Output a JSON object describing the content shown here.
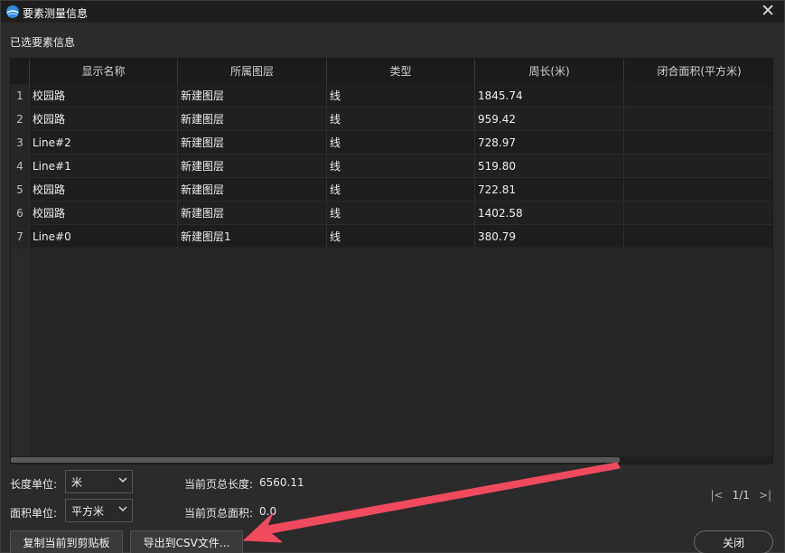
{
  "window": {
    "title": "要素测量信息"
  },
  "section": {
    "label": "已选要素信息"
  },
  "table": {
    "columns": [
      "显示名称",
      "所属图层",
      "类型",
      "周长(米)",
      "闭合面积(平方米)"
    ],
    "rows": [
      {
        "n": "1",
        "name": "校园路",
        "layer": "新建图层",
        "type": "线",
        "perimeter": "1845.74",
        "area": ""
      },
      {
        "n": "2",
        "name": "校园路",
        "layer": "新建图层",
        "type": "线",
        "perimeter": "959.42",
        "area": ""
      },
      {
        "n": "3",
        "name": "Line#2",
        "layer": "新建图层",
        "type": "线",
        "perimeter": "728.97",
        "area": ""
      },
      {
        "n": "4",
        "name": "Line#1",
        "layer": "新建图层",
        "type": "线",
        "perimeter": "519.80",
        "area": ""
      },
      {
        "n": "5",
        "name": "校园路",
        "layer": "新建图层",
        "type": "线",
        "perimeter": "722.81",
        "area": ""
      },
      {
        "n": "6",
        "name": "校园路",
        "layer": "新建图层",
        "type": "线",
        "perimeter": "1402.58",
        "area": ""
      },
      {
        "n": "7",
        "name": "Line#0",
        "layer": "新建图层1",
        "type": "线",
        "perimeter": "380.79",
        "area": ""
      }
    ]
  },
  "units": {
    "length_label": "长度单位:",
    "length_value": "米",
    "area_label": "面积单位:",
    "area_value": "平方米"
  },
  "totals": {
    "length_label": "当前页总长度:",
    "length_value": "6560.11",
    "area_label": "当前页总面积:",
    "area_value": "0.0"
  },
  "pager": {
    "first": "|<",
    "page": "1/1",
    "last": ">|"
  },
  "buttons": {
    "copy": "复制当前到剪贴板",
    "export": "导出到CSV文件...",
    "close": "关闭"
  },
  "icons": {
    "close": "close-icon",
    "app": "globe-icon",
    "chevron": "chevron-down-icon"
  },
  "colors": {
    "annotation_arrow": "#f04a5e",
    "background": "#2b2b2b"
  }
}
